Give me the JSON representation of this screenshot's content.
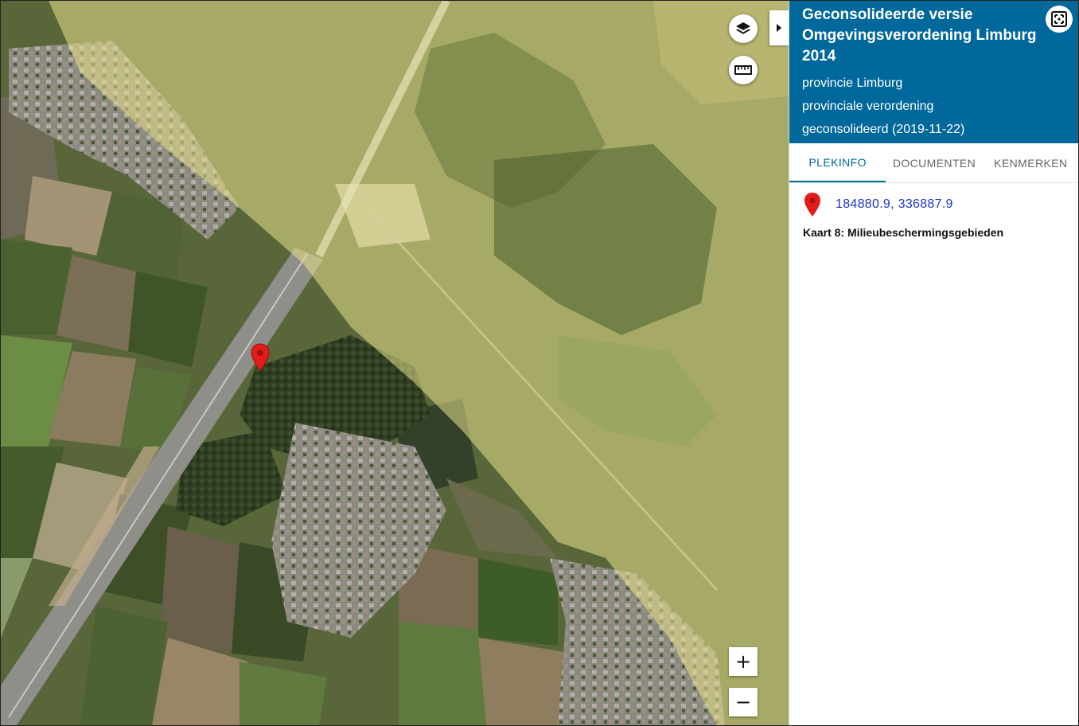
{
  "map": {
    "layers_button_icon": "layers-icon",
    "measure_button_icon": "ruler-icon",
    "zoom_in_label": "+",
    "zoom_out_label": "−",
    "collapse_icon": "caret-right-icon",
    "marker_icon": "map-pin-icon",
    "overlay_color": "#e8e28a"
  },
  "panel": {
    "title": "Geconsolideerde versie Omgevingsverordening Limburg 2014",
    "meta": [
      "provincie Limburg",
      "provinciale verordening",
      "geconsolideerd (2019-11-22)"
    ],
    "expand_icon": "expand-icon",
    "header_color": "#01689b",
    "tabs": [
      {
        "label": "PLEKINFO",
        "active": true
      },
      {
        "label": "DOCUMENTEN",
        "active": false
      },
      {
        "label": "KENMERKEN",
        "active": false
      }
    ],
    "coordinates": "184880.9, 336887.9",
    "kaart_label": "Kaart 8: Milieubeschermingsgebieden"
  }
}
